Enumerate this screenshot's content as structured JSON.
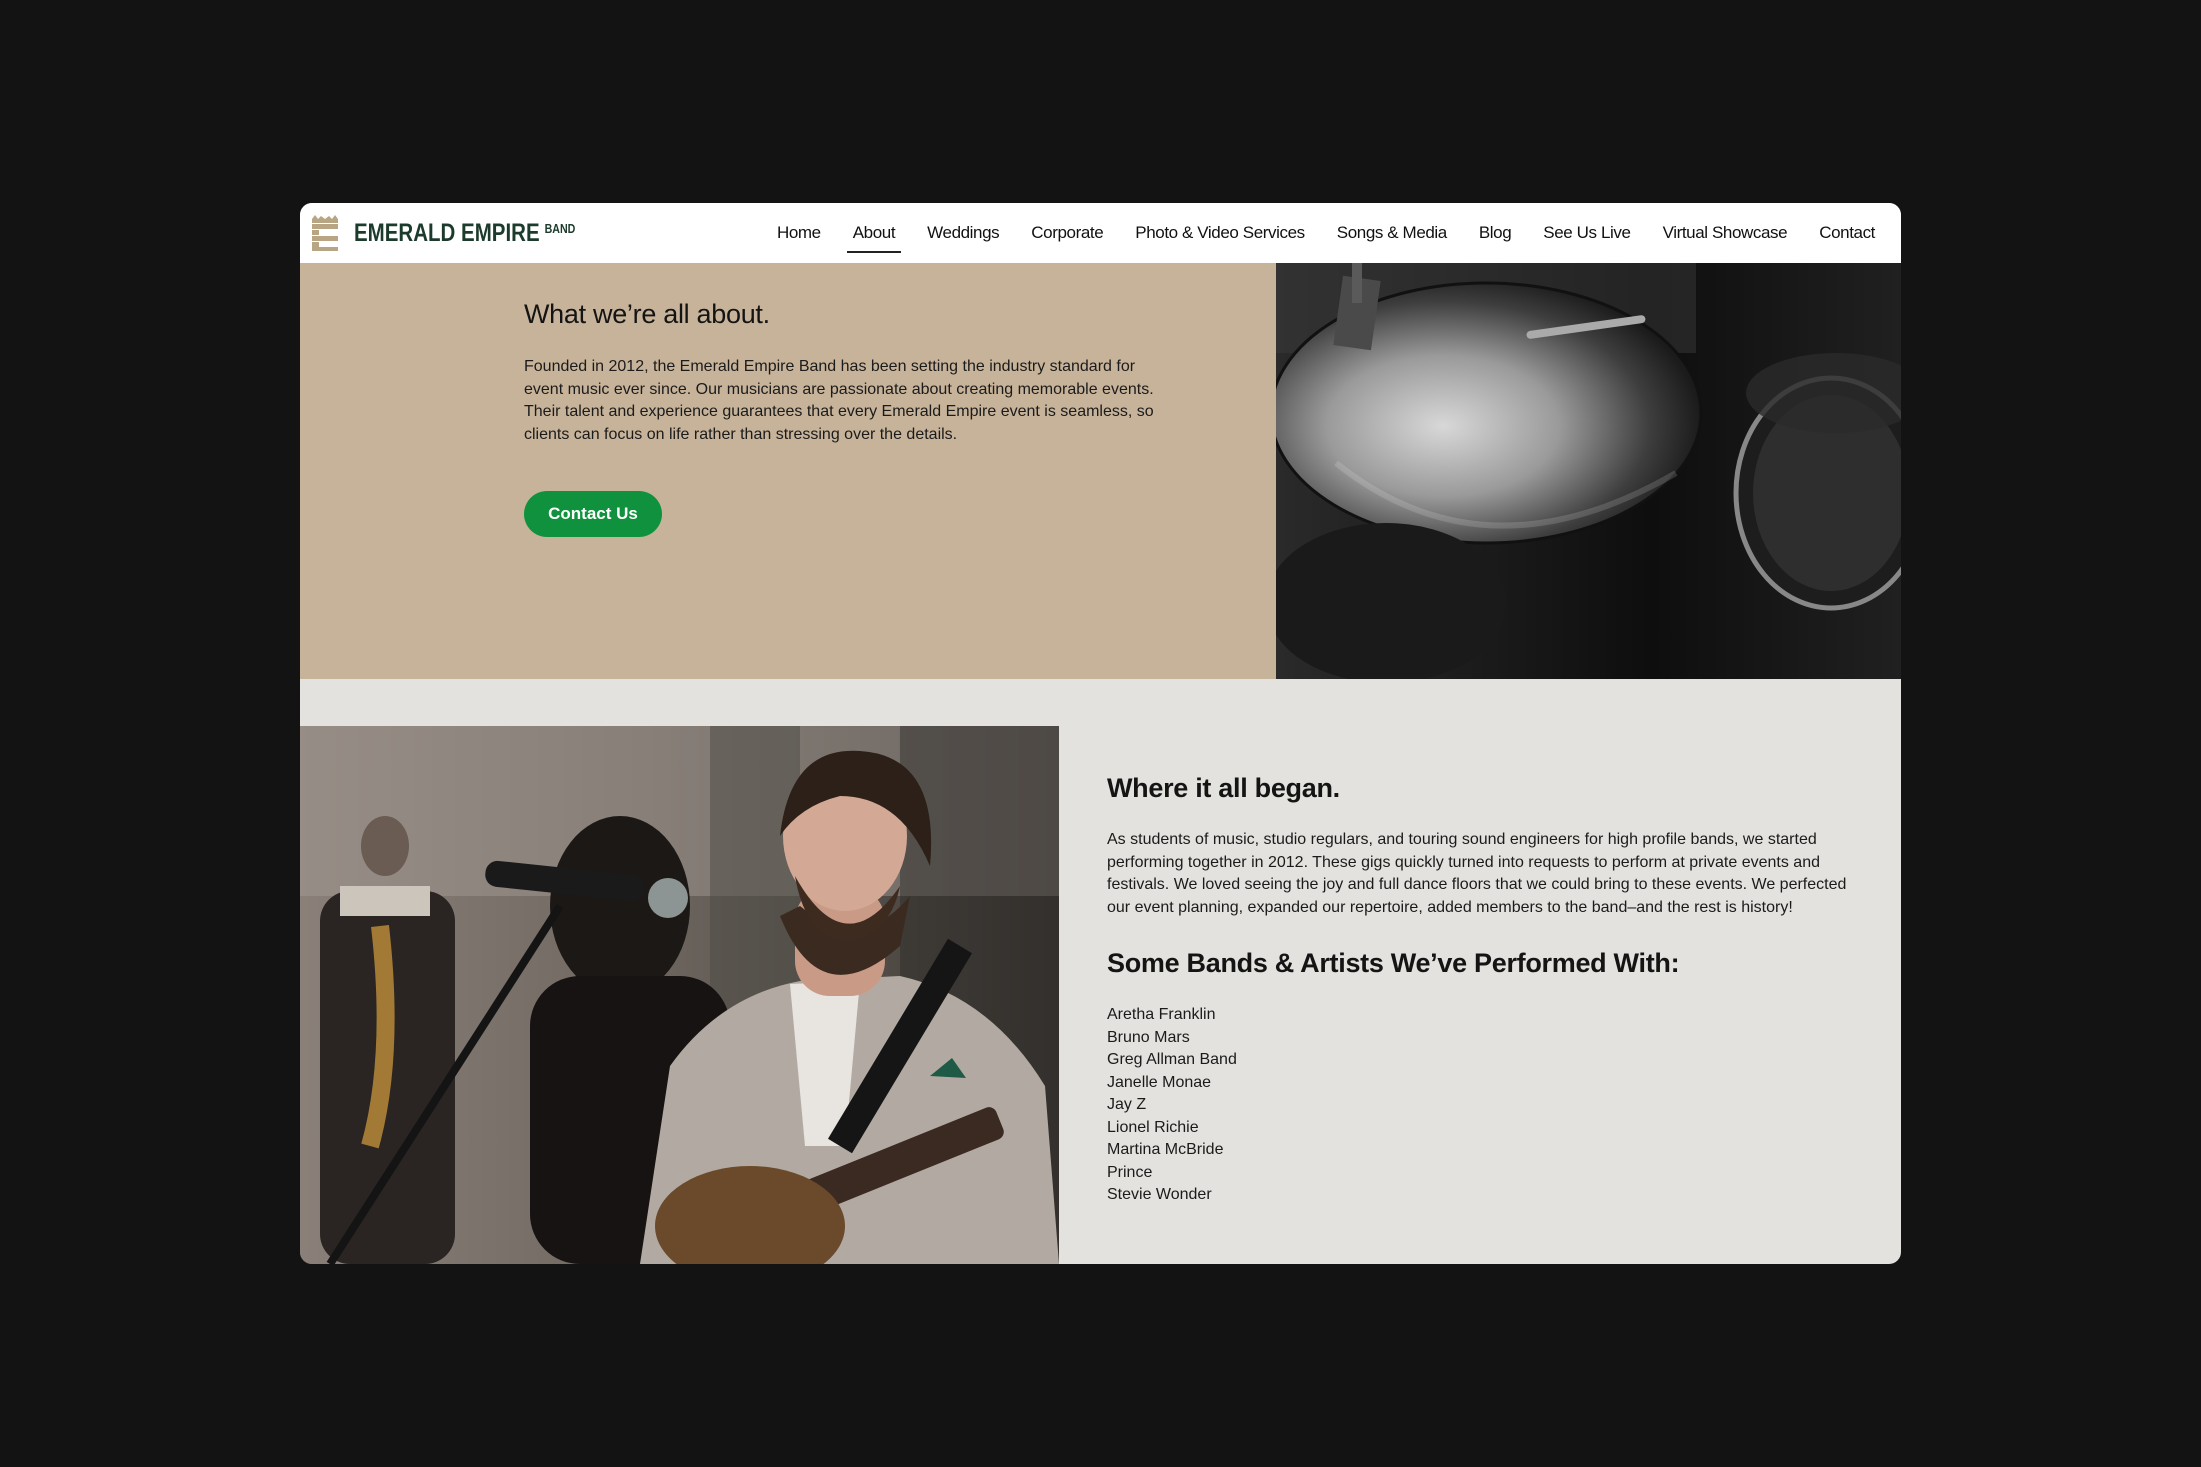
{
  "header": {
    "logo_text": "EMERALD EMPIRE",
    "logo_sup": "BAND",
    "nav": [
      {
        "label": "Home"
      },
      {
        "label": "About",
        "active": true
      },
      {
        "label": "Weddings"
      },
      {
        "label": "Corporate"
      },
      {
        "label": "Photo & Video Services"
      },
      {
        "label": "Songs & Media"
      },
      {
        "label": "Blog"
      },
      {
        "label": "See Us Live"
      },
      {
        "label": "Virtual Showcase"
      },
      {
        "label": "Contact"
      }
    ]
  },
  "about": {
    "title": "What we’re all about.",
    "text": "Founded in 2012, the Emerald Empire Band has been setting the industry standard for event music ever since. Our musicians are passionate about creating memorable events. Their talent and experience guarantees that every Emerald Empire event is seamless, so clients can focus on life rather than stressing over the details.",
    "button_label": "Contact Us"
  },
  "story": {
    "title": "Where it all began.",
    "text": "As students of music, studio regulars, and touring sound engineers for high profile bands, we started performing together in 2012. These gigs quickly turned into requests to perform at private events and festivals. We loved seeing the joy and full dance floors that we could bring to these events. We perfected our event planning, expanded our repertoire, added members to the band–and the rest is history!",
    "bands_title": "Some Bands & Artists We’ve Performed With:",
    "bands": [
      "Aretha Franklin",
      "Bruno Mars",
      "Greg Allman Band",
      "Janelle Monae",
      "Jay Z",
      "Lionel Richie",
      "Martina McBride",
      "Prince",
      "Stevie Wonder"
    ]
  },
  "colors": {
    "page_bg": "#131313",
    "header_bg": "#ffffff",
    "hero_bg": "#c7b399",
    "section_bg": "#e3e2df",
    "accent_green": "#10913e",
    "logo_green": "#1c3b2c"
  }
}
